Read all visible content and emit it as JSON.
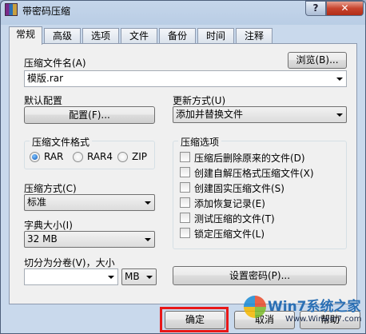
{
  "window": {
    "title": "带密码压缩",
    "help_label": "?",
    "close_label": "✕"
  },
  "tabs": [
    "常规",
    "高级",
    "选项",
    "文件",
    "备份",
    "时间",
    "注释"
  ],
  "archive_name": {
    "label": "压缩文件名(A)",
    "value": "模版.rar",
    "browse_label": "浏览(B)..."
  },
  "profile": {
    "label": "默认配置",
    "button_label": "配置(F)..."
  },
  "update_mode": {
    "label": "更新方式(U)",
    "value": "添加并替换文件"
  },
  "format": {
    "title": "压缩文件格式",
    "options": [
      "RAR",
      "RAR4",
      "ZIP"
    ],
    "selected": "RAR"
  },
  "method": {
    "label": "压缩方式(C)",
    "value": "标准"
  },
  "dictionary": {
    "label": "字典大小(I)",
    "value": "32 MB"
  },
  "volumes": {
    "label": "切分为分卷(V)，大小",
    "size_value": "",
    "unit_value": "MB"
  },
  "options": {
    "title": "压缩选项",
    "items": [
      "压缩后删除原来的文件(D)",
      "创建自解压格式压缩文件(X)",
      "创建固实压缩文件(S)",
      "添加恢复记录(E)",
      "测试压缩的文件(T)",
      "锁定压缩文件(L)"
    ]
  },
  "password_button": "设置密码(P)...",
  "buttons": {
    "ok": "确定",
    "cancel": "取消",
    "help": "帮助"
  },
  "watermark": {
    "text": "Win7系统之家",
    "url": "Www.Winwin7.com"
  },
  "colors": {
    "highlight": "#e81818",
    "radio_selected": "#0b54b4"
  }
}
